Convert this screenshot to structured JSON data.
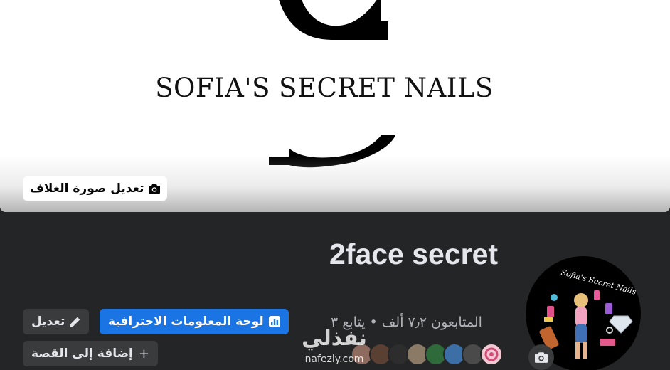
{
  "cover": {
    "brand_text": "SOFIA'S SECRET NAILS",
    "edit_cover_label": "تعديل صورة الغلاف",
    "edit_cover_icon": "camera-icon"
  },
  "profile": {
    "name": "2face secret",
    "followers_text": "المتابعون ٧٫٢ ألف • يتابع ٣",
    "avatar_text": "Sofia's Secret Nails",
    "avatar_camera_icon": "camera-icon"
  },
  "actions": {
    "dashboard_label": "لوحة المعلومات الاحترافية",
    "dashboard_icon": "bar-chart-icon",
    "edit_label": "تعديل",
    "edit_icon": "pencil-icon",
    "story_label": "إضافة إلى القصة",
    "story_icon": "plus-icon"
  },
  "watermark": {
    "arabic": "نفذلي",
    "url": "nafezly.com"
  },
  "friend_avatars": [
    "friend-1",
    "friend-2",
    "friend-3",
    "friend-4",
    "friend-5",
    "friend-6",
    "friend-7",
    "friend-8"
  ],
  "colors": {
    "background": "#242526",
    "primary": "#1b74e4",
    "secondary_button": "#3a3b3c",
    "text_primary": "#e4e6eb",
    "text_secondary": "#b0b3b8"
  }
}
